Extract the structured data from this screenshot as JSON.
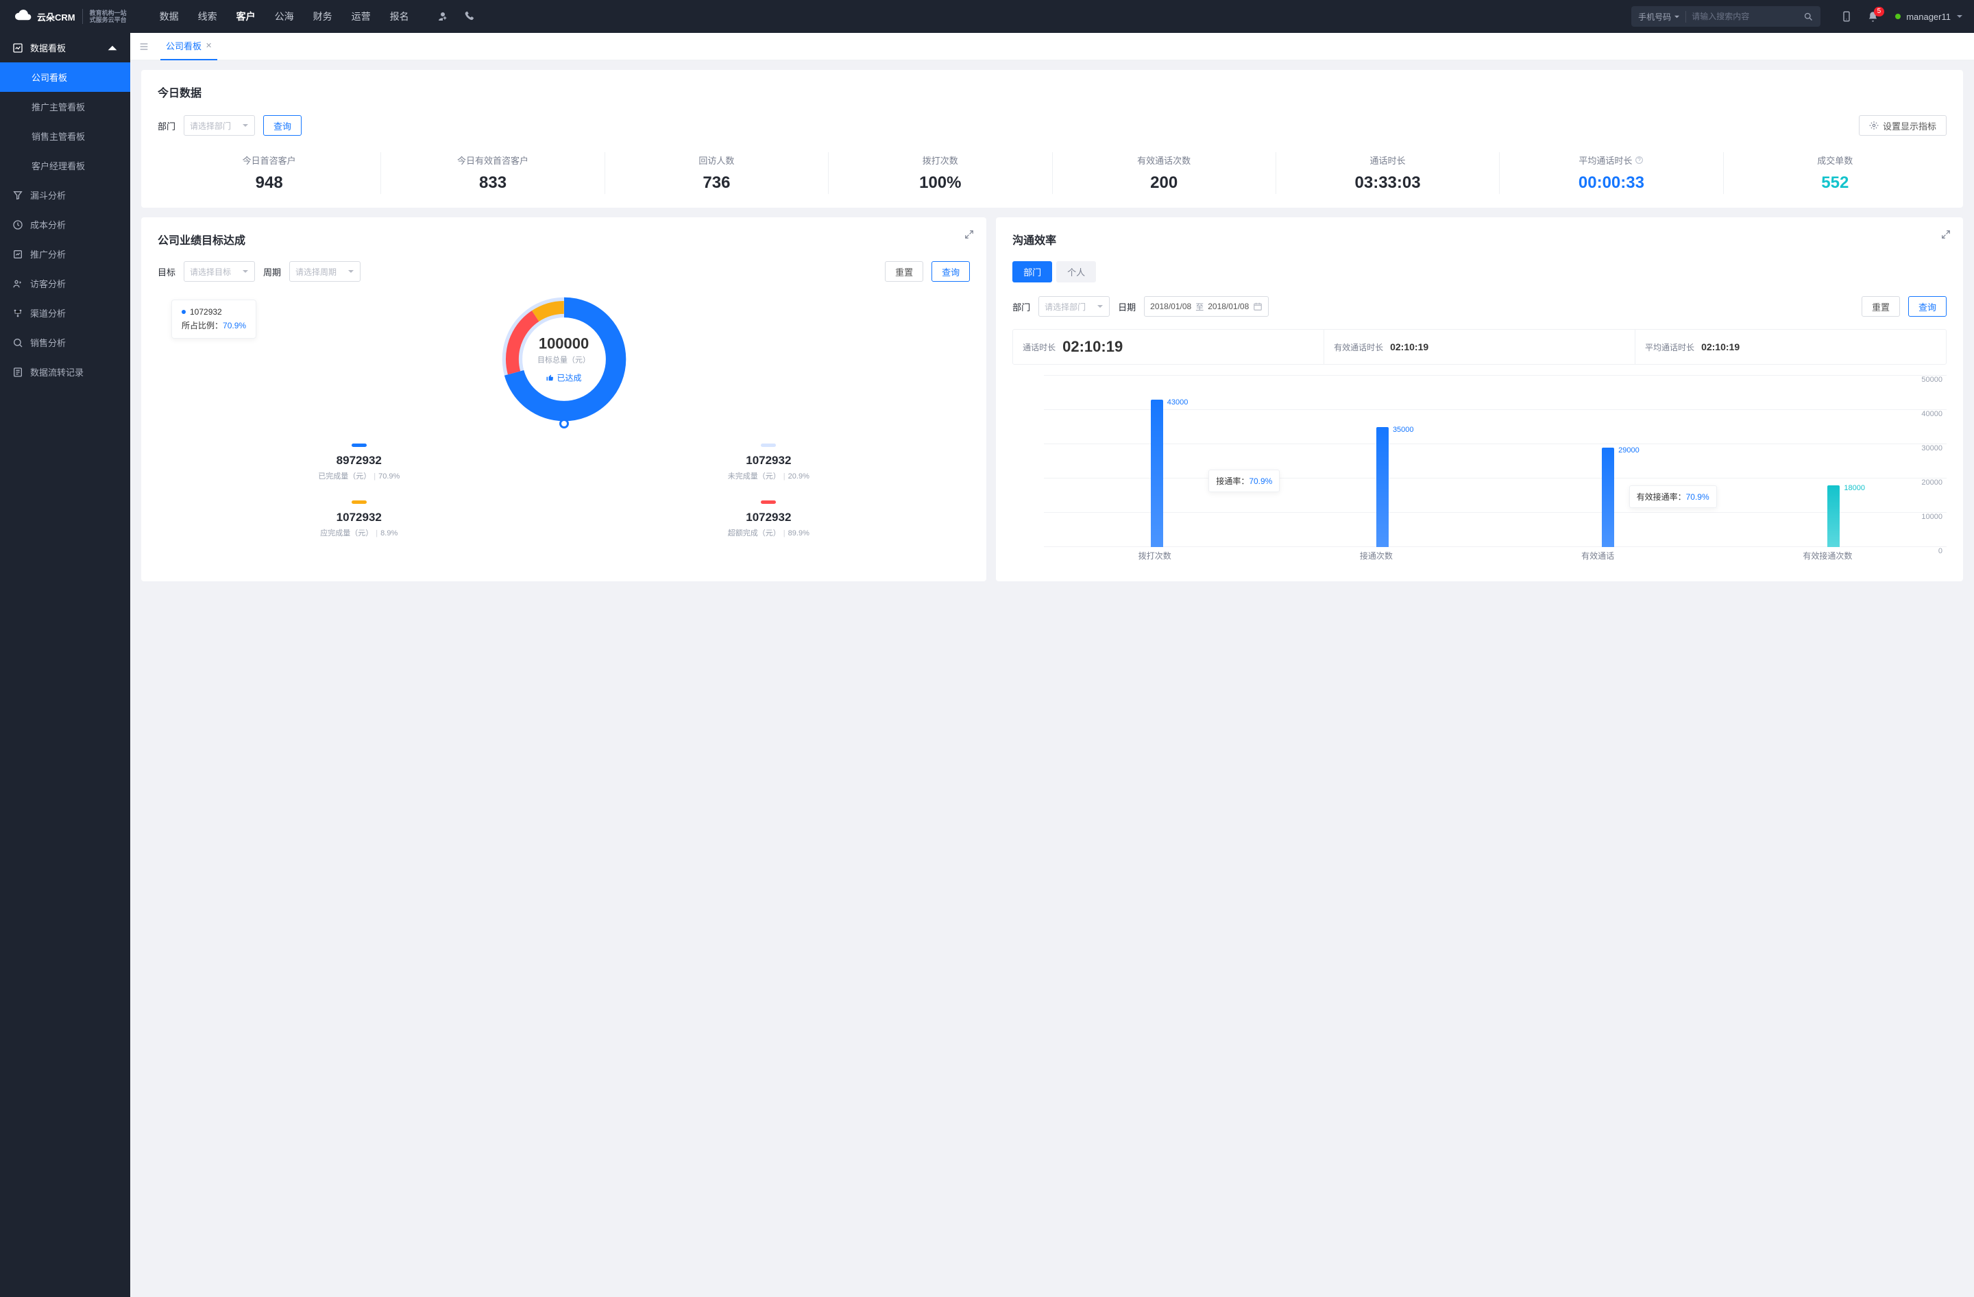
{
  "header": {
    "logo_text": "云朵CRM",
    "logo_sub1": "教育机构一站",
    "logo_sub2": "式服务云平台",
    "nav": [
      "数据",
      "线索",
      "客户",
      "公海",
      "财务",
      "运营",
      "报名"
    ],
    "nav_active": 2,
    "search_type": "手机号码",
    "search_placeholder": "请输入搜索内容",
    "badge": "5",
    "user": "manager11"
  },
  "sidebar": {
    "group": "数据看板",
    "subs": [
      "公司看板",
      "推广主管看板",
      "销售主管看板",
      "客户经理看板"
    ],
    "sub_active": 0,
    "items": [
      "漏斗分析",
      "成本分析",
      "推广分析",
      "访客分析",
      "渠道分析",
      "销售分析",
      "数据流转记录"
    ]
  },
  "tab": {
    "label": "公司看板"
  },
  "today": {
    "title": "今日数据",
    "dept_label": "部门",
    "dept_placeholder": "请选择部门",
    "query_btn": "查询",
    "settings_btn": "设置显示指标",
    "metrics": [
      {
        "label": "今日首咨客户",
        "value": "948",
        "style": ""
      },
      {
        "label": "今日有效首咨客户",
        "value": "833",
        "style": ""
      },
      {
        "label": "回访人数",
        "value": "736",
        "style": ""
      },
      {
        "label": "拨打次数",
        "value": "100%",
        "style": ""
      },
      {
        "label": "有效通话次数",
        "value": "200",
        "style": ""
      },
      {
        "label": "通话时长",
        "value": "03:33:03",
        "style": ""
      },
      {
        "label": "平均通话时长",
        "value": "00:00:33",
        "style": "blue",
        "help": true
      },
      {
        "label": "成交单数",
        "value": "552",
        "style": "cyan"
      }
    ]
  },
  "goal": {
    "title": "公司业绩目标达成",
    "target_label": "目标",
    "target_placeholder": "请选择目标",
    "period_label": "周期",
    "period_placeholder": "请选择周期",
    "reset_btn": "重置",
    "query_btn": "查询",
    "tooltip_value": "1072932",
    "tooltip_ratio_label": "所占比例：",
    "tooltip_ratio": "70.9%",
    "center_value": "100000",
    "center_sub": "目标总量（元）",
    "achieved": "已达成",
    "legend": [
      {
        "color": "#1677ff",
        "value": "8972932",
        "label": "已完成量（元）",
        "pct": "70.9%"
      },
      {
        "color": "#d6e4ff",
        "value": "1072932",
        "label": "未完成量（元）",
        "pct": "20.9%"
      },
      {
        "color": "#faad14",
        "value": "1072932",
        "label": "应完成量（元）",
        "pct": "8.9%"
      },
      {
        "color": "#ff4d4f",
        "value": "1072932",
        "label": "超额完成（元）",
        "pct": "89.9%"
      }
    ]
  },
  "comm": {
    "title": "沟通效率",
    "seg": [
      "部门",
      "个人"
    ],
    "seg_active": 0,
    "dept_label": "部门",
    "dept_placeholder": "请选择部门",
    "date_label": "日期",
    "date_from": "2018/01/08",
    "date_to_sep": "至",
    "date_to": "2018/01/08",
    "reset_btn": "重置",
    "query_btn": "查询",
    "stats": [
      {
        "k": "通话时长",
        "v": "02:10:19",
        "big": true
      },
      {
        "k": "有效通话时长",
        "v": "02:10:19"
      },
      {
        "k": "平均通话时长",
        "v": "02:10:19"
      }
    ],
    "callout1": {
      "label": "接通率：",
      "pct": "70.9%"
    },
    "callout2": {
      "label": "有效接通率：",
      "pct": "70.9%"
    }
  },
  "chart_data": {
    "type": "bar",
    "categories": [
      "拨打次数",
      "接通次数",
      "有效通话",
      "有效接通次数"
    ],
    "values": [
      43000,
      35000,
      29000,
      18000
    ],
    "ylim": [
      0,
      50000
    ],
    "yticks": [
      0,
      10000,
      20000,
      30000,
      40000,
      50000
    ]
  },
  "donut_chart": {
    "type": "pie",
    "slices": [
      {
        "name": "已完成",
        "color": "#1677ff",
        "pct": 70.9
      },
      {
        "name": "未完成/超额",
        "color": "#ff4d4f",
        "pct": 20.0
      },
      {
        "name": "应完成",
        "color": "#faad14",
        "pct": 9.1
      }
    ]
  }
}
